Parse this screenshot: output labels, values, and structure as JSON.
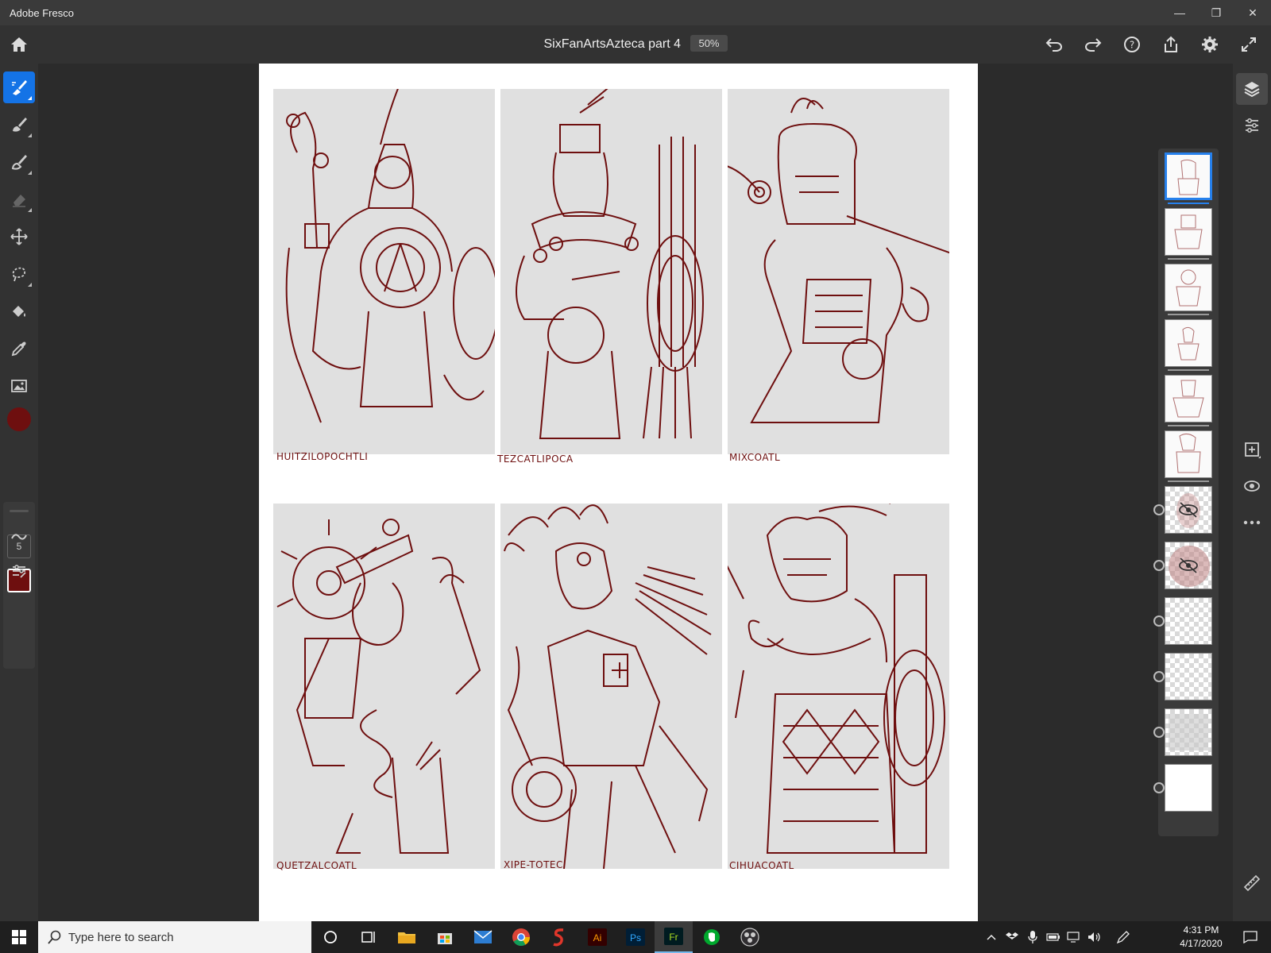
{
  "window": {
    "app_name": "Adobe Fresco",
    "minimize": "—",
    "maximize": "❐",
    "close": "✕"
  },
  "header": {
    "document_title": "SixFanArtsAzteca part 4",
    "zoom": "50%"
  },
  "tools": {
    "brush_size": "5",
    "color": "#6e0f0f"
  },
  "canvas": {
    "panels": [
      {
        "label": "HUITZILOPOCHTLI"
      },
      {
        "label": "TEZCATLIPOCA"
      },
      {
        "label": "MIXCOATL"
      },
      {
        "label": "QUETZALCOATL"
      },
      {
        "label": "XIPE-TOTEC"
      },
      {
        "label": "CIHUACOATL"
      }
    ]
  },
  "layers": [
    {
      "state": "selected"
    },
    {
      "state": "normal"
    },
    {
      "state": "normal"
    },
    {
      "state": "normal"
    },
    {
      "state": "normal"
    },
    {
      "state": "normal"
    },
    {
      "state": "hidden"
    },
    {
      "state": "hidden"
    },
    {
      "state": "transparent"
    },
    {
      "state": "transparent"
    },
    {
      "state": "transparent"
    },
    {
      "state": "background"
    }
  ],
  "taskbar": {
    "search_placeholder": "Type here to search",
    "time": "4:31 PM",
    "date": "4/17/2020",
    "apps": [
      "cortana",
      "task-view",
      "file-explorer",
      "store",
      "mail",
      "chrome",
      "app-s",
      "illustrator",
      "photoshop",
      "fresco",
      "evernote",
      "obs"
    ]
  },
  "colors": {
    "accent": "#1473e6",
    "ink": "#6e0f0f",
    "panel_bg": "#e0e0e0"
  }
}
